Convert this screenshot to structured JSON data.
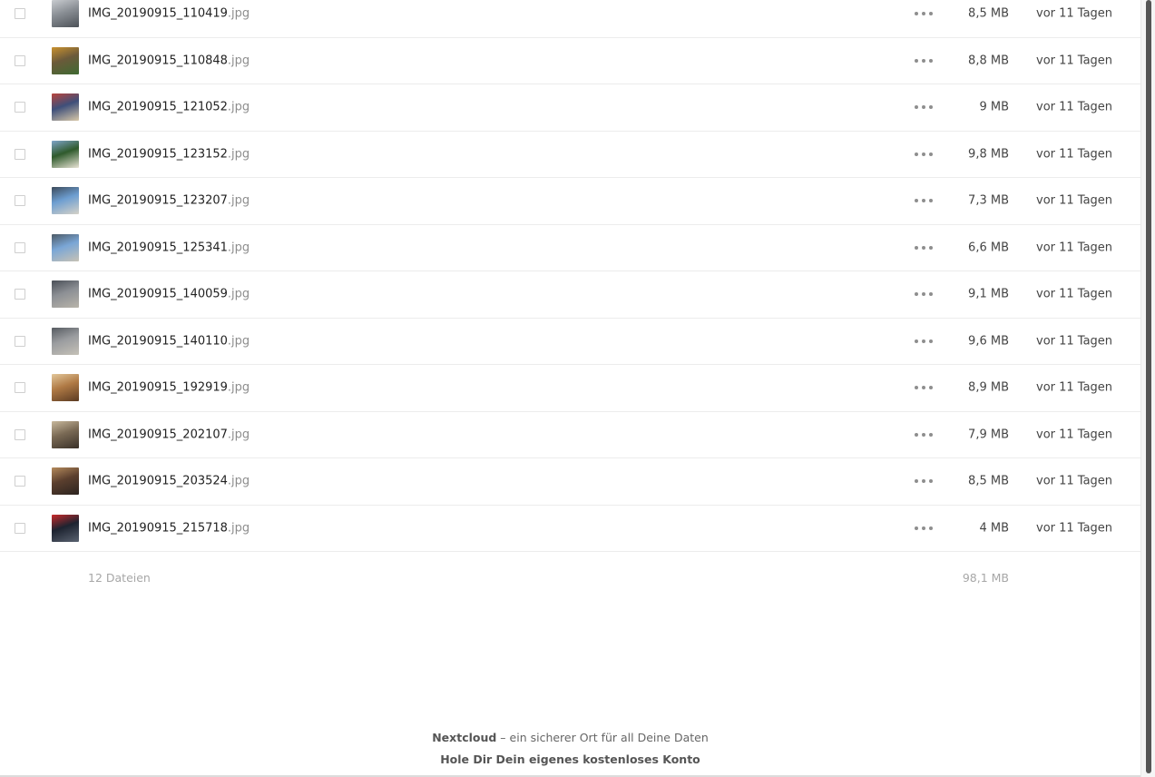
{
  "files": [
    {
      "base": "IMG_20190915_110419",
      "ext": ".jpg",
      "size": "8,5 MB",
      "modified": "vor 11 Tagen",
      "thumb_colors": [
        "#8a8f95",
        "#c9ccd0",
        "#4d5258"
      ]
    },
    {
      "base": "IMG_20190915_110848",
      "ext": ".jpg",
      "size": "8,8 MB",
      "modified": "vor 11 Tagen",
      "thumb_colors": [
        "#6b5a3a",
        "#c9912f",
        "#3f6a32"
      ]
    },
    {
      "base": "IMG_20190915_121052",
      "ext": ".jpg",
      "size": "9 MB",
      "modified": "vor 11 Tagen",
      "thumb_colors": [
        "#3e4f7a",
        "#b9443c",
        "#d8c8a8"
      ]
    },
    {
      "base": "IMG_20190915_123152",
      "ext": ".jpg",
      "size": "9,8 MB",
      "modified": "vor 11 Tagen",
      "thumb_colors": [
        "#2f5a2c",
        "#7fa4c9",
        "#e9e4d6"
      ]
    },
    {
      "base": "IMG_20190915_123207",
      "ext": ".jpg",
      "size": "7,3 MB",
      "modified": "vor 11 Tagen",
      "thumb_colors": [
        "#6d9ed1",
        "#3c4a5a",
        "#d6d2c8"
      ]
    },
    {
      "base": "IMG_20190915_125341",
      "ext": ".jpg",
      "size": "6,6 MB",
      "modified": "vor 11 Tagen",
      "thumb_colors": [
        "#7aa6d6",
        "#4d5a66",
        "#c7c2b5"
      ]
    },
    {
      "base": "IMG_20190915_140059",
      "ext": ".jpg",
      "size": "9,1 MB",
      "modified": "vor 11 Tagen",
      "thumb_colors": [
        "#8c8f94",
        "#4a4f57",
        "#b8b4aa"
      ]
    },
    {
      "base": "IMG_20190915_140110",
      "ext": ".jpg",
      "size": "9,6 MB",
      "modified": "vor 11 Tagen",
      "thumb_colors": [
        "#9a9c9f",
        "#565b61",
        "#c5c1b7"
      ]
    },
    {
      "base": "IMG_20190915_192919",
      "ext": ".jpg",
      "size": "8,9 MB",
      "modified": "vor 11 Tagen",
      "thumb_colors": [
        "#b07a45",
        "#e3c79a",
        "#5b3b22"
      ]
    },
    {
      "base": "IMG_20190915_202107",
      "ext": ".jpg",
      "size": "7,9 MB",
      "modified": "vor 11 Tagen",
      "thumb_colors": [
        "#7a6a55",
        "#c8b89c",
        "#3a3128"
      ]
    },
    {
      "base": "IMG_20190915_203524",
      "ext": ".jpg",
      "size": "8,5 MB",
      "modified": "vor 11 Tagen",
      "thumb_colors": [
        "#5b3f2e",
        "#b48a5c",
        "#2c2420"
      ]
    },
    {
      "base": "IMG_20190915_215718",
      "ext": ".jpg",
      "size": "4 MB",
      "modified": "vor 11 Tagen",
      "thumb_colors": [
        "#1d2330",
        "#c92a2a",
        "#5a6270"
      ]
    }
  ],
  "summary": {
    "count": "12 Dateien",
    "total": "98,1 MB"
  },
  "footer": {
    "brand": "Nextcloud",
    "tagline": " – ein sicherer Ort für all Deine Daten",
    "signup": "Hole Dir Dein eigenes kostenloses Konto"
  }
}
